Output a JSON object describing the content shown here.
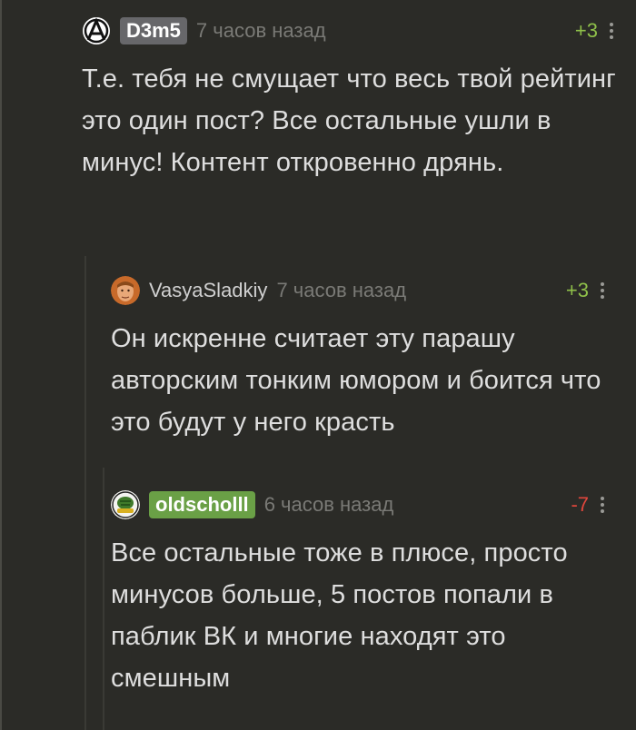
{
  "comments": [
    {
      "username": "D3m5",
      "time": "7 часов назад",
      "rating": "+3",
      "avatar_icon": "anarchy-symbol-icon",
      "text": "Т.е. тебя не смущает что весь твой рейтинг это один пост? Все остальные ушли в минус! Контент откровенно дрянь."
    },
    {
      "username": "VasyaSladkiy",
      "time": "7 часов назад",
      "rating": "+3",
      "avatar_icon": "user-photo-avatar",
      "text": "Он искренне считает эту парашу авторским тонким юмором и боится что это будут у него красть"
    },
    {
      "username": "oldscholll",
      "time": "6 часов назад",
      "rating": "-7",
      "avatar_icon": "turtle-logo-avatar",
      "text": "Все остальные тоже в плюсе, просто минусов больше, 5 постов попали в паблик ВК и многие находят это смешным"
    }
  ],
  "colors": {
    "background": "#2b2b27",
    "positive": "#8fc04a",
    "negative": "#e0463c",
    "badge_gray": "#67676a",
    "badge_green": "#6aa046"
  }
}
